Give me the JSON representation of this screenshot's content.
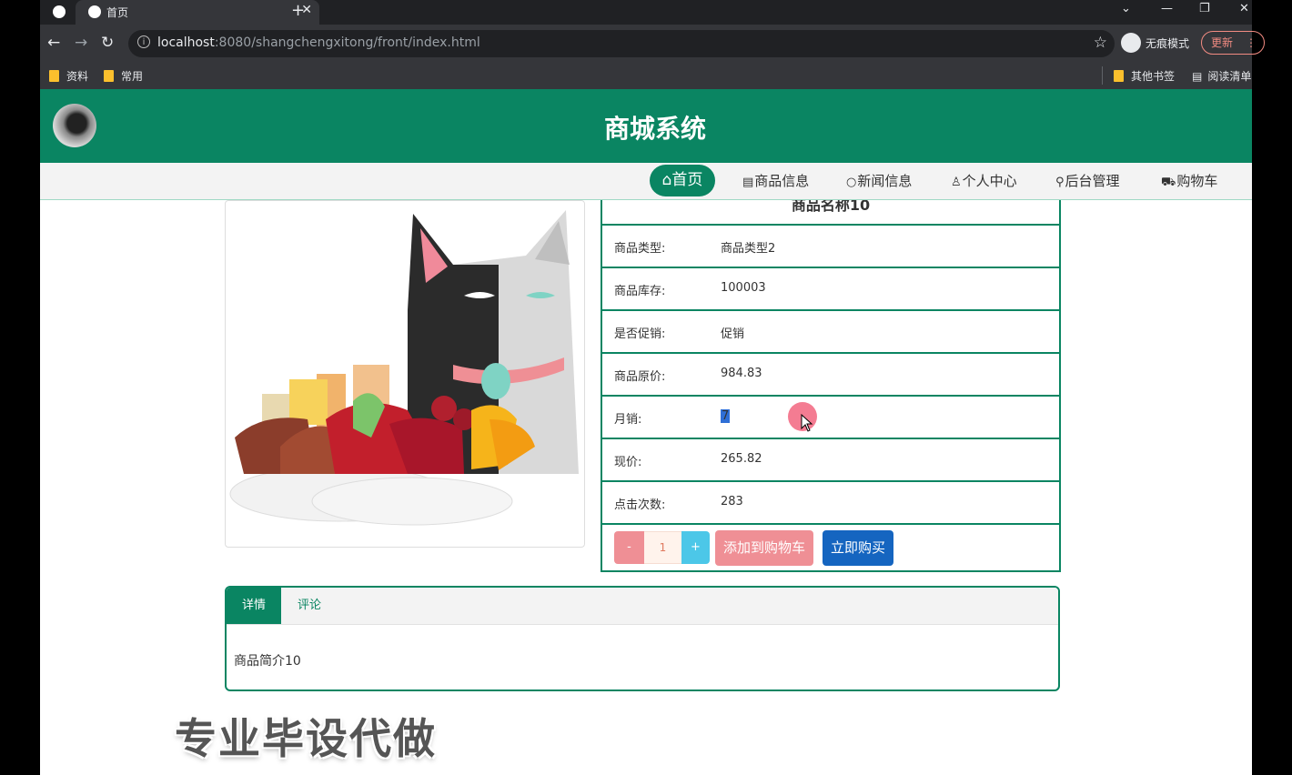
{
  "browser": {
    "tab_title": "首页",
    "url_host": "localhost",
    "url_rest": ":8080/shangchengxitong/front/index.html",
    "incognito_label": "无痕模式",
    "update_label": "更新",
    "bookmarks": [
      "资料",
      "常用"
    ],
    "other_bookmarks": "其他书签",
    "reading_list": "阅读清单"
  },
  "site": {
    "title": "商城系统"
  },
  "nav": {
    "home": "首页",
    "items": [
      "商品信息",
      "新闻信息",
      "个人中心",
      "后台管理",
      "购物车"
    ]
  },
  "product": {
    "name": "商品名称10",
    "rows": [
      {
        "label": "商品类型:",
        "value": "商品类型2"
      },
      {
        "label": "商品库存:",
        "value": "100003"
      },
      {
        "label": "是否促销:",
        "value": "促销"
      },
      {
        "label": "商品原价:",
        "value": "984.83"
      },
      {
        "label": "月销:",
        "value": "7"
      },
      {
        "label": "现价:",
        "value": "265.82"
      },
      {
        "label": "点击次数:",
        "value": "283"
      }
    ],
    "quantity": "1",
    "minus_label": "-",
    "plus_label": "+",
    "add_to_cart": "添加到购物车",
    "buy_now": "立即购买"
  },
  "tabs": {
    "detail": "详情",
    "comment": "评论",
    "detail_content": "商品简介10"
  },
  "watermark": "专业毕设代做",
  "colors": {
    "brand_green": "#0a8562",
    "pink_button": "#ef8f95",
    "blue_button": "#1565c0",
    "plus_button": "#4cc7e8"
  }
}
